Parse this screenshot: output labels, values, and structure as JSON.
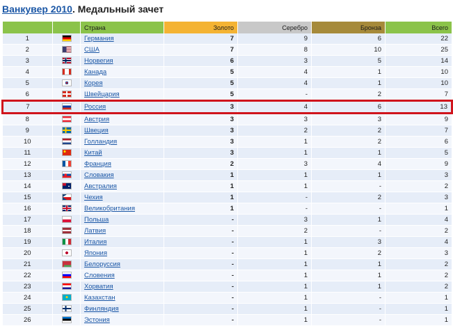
{
  "title": {
    "link": "Ванкувер 2010",
    "rest": ". Медальный зачет"
  },
  "headers": {
    "country": "Страна",
    "gold": "Золото",
    "silver": "Серебро",
    "bronze": "Бронза",
    "total": "Всего"
  },
  "rows": [
    {
      "rank": "1",
      "country": "Германия",
      "gold": "7",
      "silver": "9",
      "bronze": "6",
      "total": "22",
      "flag": "germany",
      "highlight": false
    },
    {
      "rank": "2",
      "country": "США",
      "gold": "7",
      "silver": "8",
      "bronze": "10",
      "total": "25",
      "flag": "usa",
      "highlight": false
    },
    {
      "rank": "3",
      "country": "Норвегия",
      "gold": "6",
      "silver": "3",
      "bronze": "5",
      "total": "14",
      "flag": "norway",
      "highlight": false
    },
    {
      "rank": "4",
      "country": "Канада",
      "gold": "5",
      "silver": "4",
      "bronze": "1",
      "total": "10",
      "flag": "canada",
      "highlight": false
    },
    {
      "rank": "5",
      "country": "Корея",
      "gold": "5",
      "silver": "4",
      "bronze": "1",
      "total": "10",
      "flag": "korea",
      "highlight": false
    },
    {
      "rank": "6",
      "country": "Швейцария",
      "gold": "5",
      "silver": "-",
      "bronze": "2",
      "total": "7",
      "flag": "switzerland",
      "highlight": false
    },
    {
      "rank": "7",
      "country": "Россия",
      "gold": "3",
      "silver": "4",
      "bronze": "6",
      "total": "13",
      "flag": "russia",
      "highlight": true
    },
    {
      "rank": "8",
      "country": "Австрия",
      "gold": "3",
      "silver": "3",
      "bronze": "3",
      "total": "9",
      "flag": "austria",
      "highlight": false
    },
    {
      "rank": "9",
      "country": "Швеция",
      "gold": "3",
      "silver": "2",
      "bronze": "2",
      "total": "7",
      "flag": "sweden",
      "highlight": false
    },
    {
      "rank": "10",
      "country": "Голландия",
      "gold": "3",
      "silver": "1",
      "bronze": "2",
      "total": "6",
      "flag": "netherlands",
      "highlight": false
    },
    {
      "rank": "11",
      "country": "Китай",
      "gold": "3",
      "silver": "1",
      "bronze": "1",
      "total": "5",
      "flag": "china",
      "highlight": false
    },
    {
      "rank": "12",
      "country": "Франция",
      "gold": "2",
      "silver": "3",
      "bronze": "4",
      "total": "9",
      "flag": "france",
      "highlight": false
    },
    {
      "rank": "13",
      "country": "Словакия",
      "gold": "1",
      "silver": "1",
      "bronze": "1",
      "total": "3",
      "flag": "slovakia",
      "highlight": false
    },
    {
      "rank": "14",
      "country": "Австралия",
      "gold": "1",
      "silver": "1",
      "bronze": "-",
      "total": "2",
      "flag": "australia",
      "highlight": false
    },
    {
      "rank": "15",
      "country": "Чехия",
      "gold": "1",
      "silver": "-",
      "bronze": "2",
      "total": "3",
      "flag": "czech",
      "highlight": false
    },
    {
      "rank": "16",
      "country": "Великобритания",
      "gold": "1",
      "silver": "-",
      "bronze": "-",
      "total": "1",
      "flag": "uk",
      "highlight": false
    },
    {
      "rank": "17",
      "country": "Польша",
      "gold": "-",
      "silver": "3",
      "bronze": "1",
      "total": "4",
      "flag": "poland",
      "highlight": false
    },
    {
      "rank": "18",
      "country": "Латвия",
      "gold": "-",
      "silver": "2",
      "bronze": "-",
      "total": "2",
      "flag": "latvia",
      "highlight": false
    },
    {
      "rank": "19",
      "country": "Италия",
      "gold": "-",
      "silver": "1",
      "bronze": "3",
      "total": "4",
      "flag": "italy",
      "highlight": false
    },
    {
      "rank": "20",
      "country": "Япония",
      "gold": "-",
      "silver": "1",
      "bronze": "2",
      "total": "3",
      "flag": "japan",
      "highlight": false
    },
    {
      "rank": "21",
      "country": "Белоруссия",
      "gold": "-",
      "silver": "1",
      "bronze": "1",
      "total": "2",
      "flag": "belarus",
      "highlight": false
    },
    {
      "rank": "22",
      "country": "Словения",
      "gold": "-",
      "silver": "1",
      "bronze": "1",
      "total": "2",
      "flag": "slovenia",
      "highlight": false
    },
    {
      "rank": "23",
      "country": "Хорватия",
      "gold": "-",
      "silver": "1",
      "bronze": "1",
      "total": "2",
      "flag": "croatia",
      "highlight": false
    },
    {
      "rank": "24",
      "country": "Казахстан",
      "gold": "-",
      "silver": "1",
      "bronze": "-",
      "total": "1",
      "flag": "kazakhstan",
      "highlight": false
    },
    {
      "rank": "25",
      "country": "Финляндия",
      "gold": "-",
      "silver": "1",
      "bronze": "-",
      "total": "1",
      "flag": "finland",
      "highlight": false
    },
    {
      "rank": "26",
      "country": "Эстония",
      "gold": "-",
      "silver": "1",
      "bronze": "-",
      "total": "1",
      "flag": "estonia",
      "highlight": false
    }
  ],
  "colors": {
    "gold": "#f4b333",
    "silver": "#c8c8c8",
    "bronze": "#a68a3a",
    "green": "#8bc34a",
    "highlight": "#d0141c",
    "link": "#1b57a6"
  }
}
